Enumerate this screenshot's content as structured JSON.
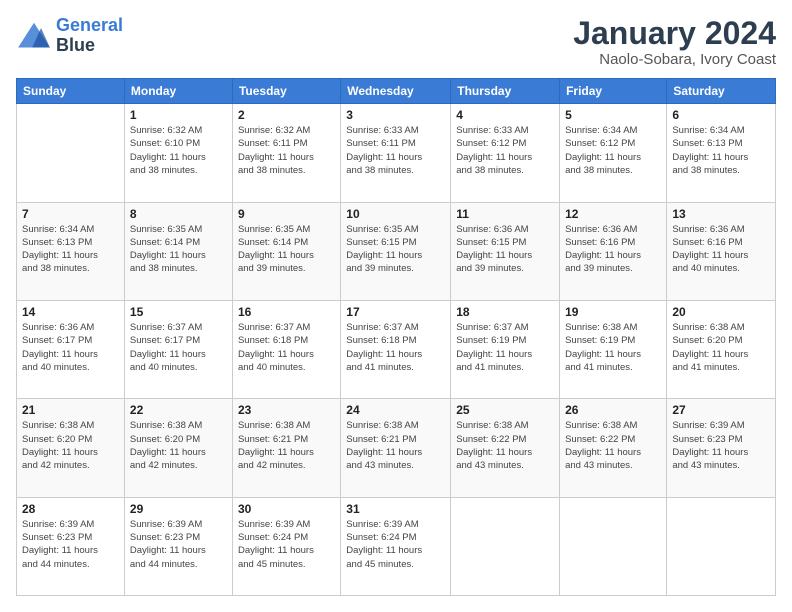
{
  "logo": {
    "line1": "General",
    "line2": "Blue"
  },
  "title": "January 2024",
  "subtitle": "Naolo-Sobara, Ivory Coast",
  "days_of_week": [
    "Sunday",
    "Monday",
    "Tuesday",
    "Wednesday",
    "Thursday",
    "Friday",
    "Saturday"
  ],
  "weeks": [
    [
      {
        "day": "",
        "info": ""
      },
      {
        "day": "1",
        "info": "Sunrise: 6:32 AM\nSunset: 6:10 PM\nDaylight: 11 hours\nand 38 minutes."
      },
      {
        "day": "2",
        "info": "Sunrise: 6:32 AM\nSunset: 6:11 PM\nDaylight: 11 hours\nand 38 minutes."
      },
      {
        "day": "3",
        "info": "Sunrise: 6:33 AM\nSunset: 6:11 PM\nDaylight: 11 hours\nand 38 minutes."
      },
      {
        "day": "4",
        "info": "Sunrise: 6:33 AM\nSunset: 6:12 PM\nDaylight: 11 hours\nand 38 minutes."
      },
      {
        "day": "5",
        "info": "Sunrise: 6:34 AM\nSunset: 6:12 PM\nDaylight: 11 hours\nand 38 minutes."
      },
      {
        "day": "6",
        "info": "Sunrise: 6:34 AM\nSunset: 6:13 PM\nDaylight: 11 hours\nand 38 minutes."
      }
    ],
    [
      {
        "day": "7",
        "info": "Sunrise: 6:34 AM\nSunset: 6:13 PM\nDaylight: 11 hours\nand 38 minutes."
      },
      {
        "day": "8",
        "info": "Sunrise: 6:35 AM\nSunset: 6:14 PM\nDaylight: 11 hours\nand 38 minutes."
      },
      {
        "day": "9",
        "info": "Sunrise: 6:35 AM\nSunset: 6:14 PM\nDaylight: 11 hours\nand 39 minutes."
      },
      {
        "day": "10",
        "info": "Sunrise: 6:35 AM\nSunset: 6:15 PM\nDaylight: 11 hours\nand 39 minutes."
      },
      {
        "day": "11",
        "info": "Sunrise: 6:36 AM\nSunset: 6:15 PM\nDaylight: 11 hours\nand 39 minutes."
      },
      {
        "day": "12",
        "info": "Sunrise: 6:36 AM\nSunset: 6:16 PM\nDaylight: 11 hours\nand 39 minutes."
      },
      {
        "day": "13",
        "info": "Sunrise: 6:36 AM\nSunset: 6:16 PM\nDaylight: 11 hours\nand 40 minutes."
      }
    ],
    [
      {
        "day": "14",
        "info": "Sunrise: 6:36 AM\nSunset: 6:17 PM\nDaylight: 11 hours\nand 40 minutes."
      },
      {
        "day": "15",
        "info": "Sunrise: 6:37 AM\nSunset: 6:17 PM\nDaylight: 11 hours\nand 40 minutes."
      },
      {
        "day": "16",
        "info": "Sunrise: 6:37 AM\nSunset: 6:18 PM\nDaylight: 11 hours\nand 40 minutes."
      },
      {
        "day": "17",
        "info": "Sunrise: 6:37 AM\nSunset: 6:18 PM\nDaylight: 11 hours\nand 41 minutes."
      },
      {
        "day": "18",
        "info": "Sunrise: 6:37 AM\nSunset: 6:19 PM\nDaylight: 11 hours\nand 41 minutes."
      },
      {
        "day": "19",
        "info": "Sunrise: 6:38 AM\nSunset: 6:19 PM\nDaylight: 11 hours\nand 41 minutes."
      },
      {
        "day": "20",
        "info": "Sunrise: 6:38 AM\nSunset: 6:20 PM\nDaylight: 11 hours\nand 41 minutes."
      }
    ],
    [
      {
        "day": "21",
        "info": "Sunrise: 6:38 AM\nSunset: 6:20 PM\nDaylight: 11 hours\nand 42 minutes."
      },
      {
        "day": "22",
        "info": "Sunrise: 6:38 AM\nSunset: 6:20 PM\nDaylight: 11 hours\nand 42 minutes."
      },
      {
        "day": "23",
        "info": "Sunrise: 6:38 AM\nSunset: 6:21 PM\nDaylight: 11 hours\nand 42 minutes."
      },
      {
        "day": "24",
        "info": "Sunrise: 6:38 AM\nSunset: 6:21 PM\nDaylight: 11 hours\nand 43 minutes."
      },
      {
        "day": "25",
        "info": "Sunrise: 6:38 AM\nSunset: 6:22 PM\nDaylight: 11 hours\nand 43 minutes."
      },
      {
        "day": "26",
        "info": "Sunrise: 6:38 AM\nSunset: 6:22 PM\nDaylight: 11 hours\nand 43 minutes."
      },
      {
        "day": "27",
        "info": "Sunrise: 6:39 AM\nSunset: 6:23 PM\nDaylight: 11 hours\nand 43 minutes."
      }
    ],
    [
      {
        "day": "28",
        "info": "Sunrise: 6:39 AM\nSunset: 6:23 PM\nDaylight: 11 hours\nand 44 minutes."
      },
      {
        "day": "29",
        "info": "Sunrise: 6:39 AM\nSunset: 6:23 PM\nDaylight: 11 hours\nand 44 minutes."
      },
      {
        "day": "30",
        "info": "Sunrise: 6:39 AM\nSunset: 6:24 PM\nDaylight: 11 hours\nand 45 minutes."
      },
      {
        "day": "31",
        "info": "Sunrise: 6:39 AM\nSunset: 6:24 PM\nDaylight: 11 hours\nand 45 minutes."
      },
      {
        "day": "",
        "info": ""
      },
      {
        "day": "",
        "info": ""
      },
      {
        "day": "",
        "info": ""
      }
    ]
  ]
}
